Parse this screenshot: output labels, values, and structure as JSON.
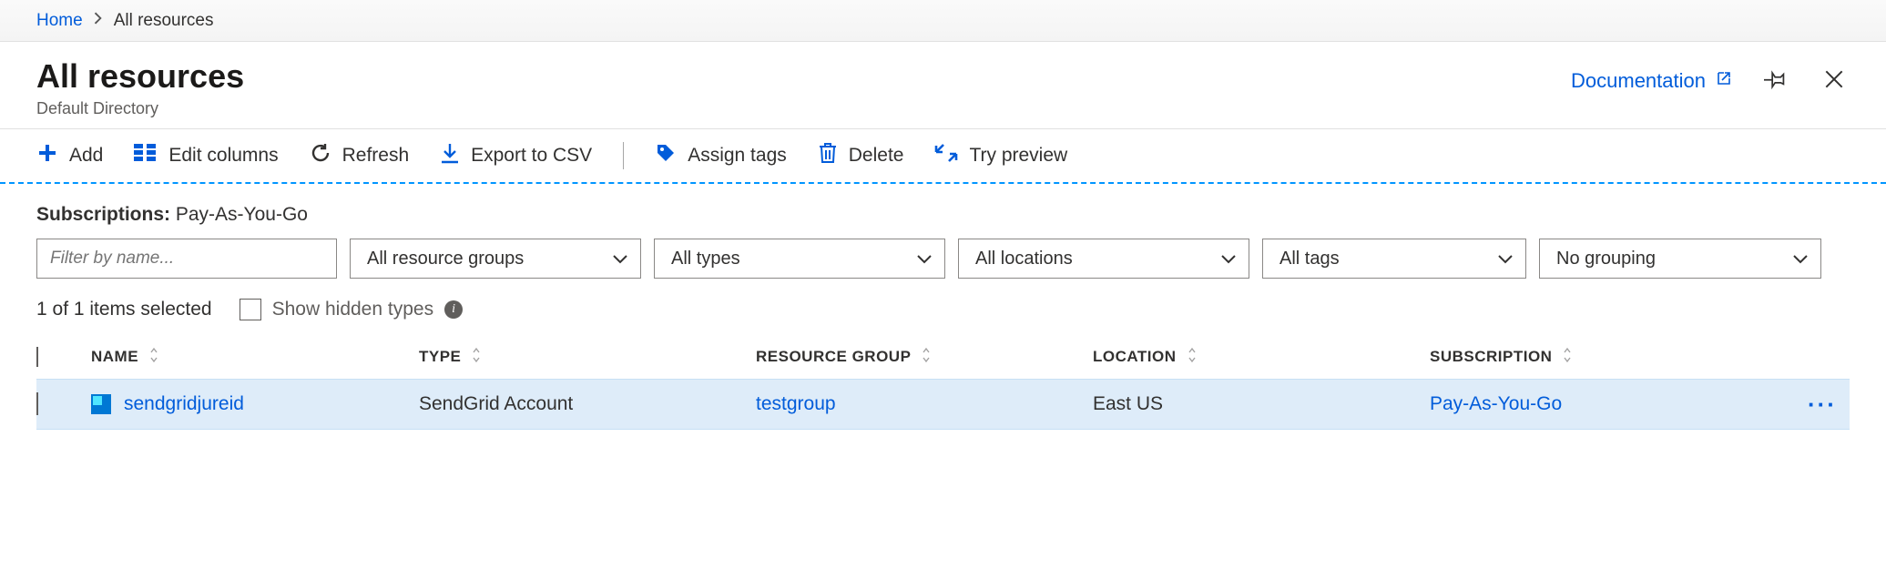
{
  "breadcrumb": {
    "home": "Home",
    "current": "All resources"
  },
  "header": {
    "title": "All resources",
    "subtitle": "Default Directory",
    "documentation": "Documentation"
  },
  "toolbar": {
    "add": "Add",
    "edit_columns": "Edit columns",
    "refresh": "Refresh",
    "export_csv": "Export to CSV",
    "assign_tags": "Assign tags",
    "delete": "Delete",
    "try_preview": "Try preview"
  },
  "subscriptions": {
    "label": "Subscriptions:",
    "value": "Pay-As-You-Go"
  },
  "filters": {
    "name_placeholder": "Filter by name...",
    "resource_groups": "All resource groups",
    "types": "All types",
    "locations": "All locations",
    "tags": "All tags",
    "grouping": "No grouping"
  },
  "selection": {
    "count_text": "1 of 1 items selected",
    "show_hidden": "Show hidden types"
  },
  "columns": {
    "name": "NAME",
    "type": "TYPE",
    "resource_group": "RESOURCE GROUP",
    "location": "LOCATION",
    "subscription": "SUBSCRIPTION"
  },
  "rows": [
    {
      "name": "sendgridjureid",
      "type": "SendGrid Account",
      "resource_group": "testgroup",
      "location": "East US",
      "subscription": "Pay-As-You-Go"
    }
  ]
}
